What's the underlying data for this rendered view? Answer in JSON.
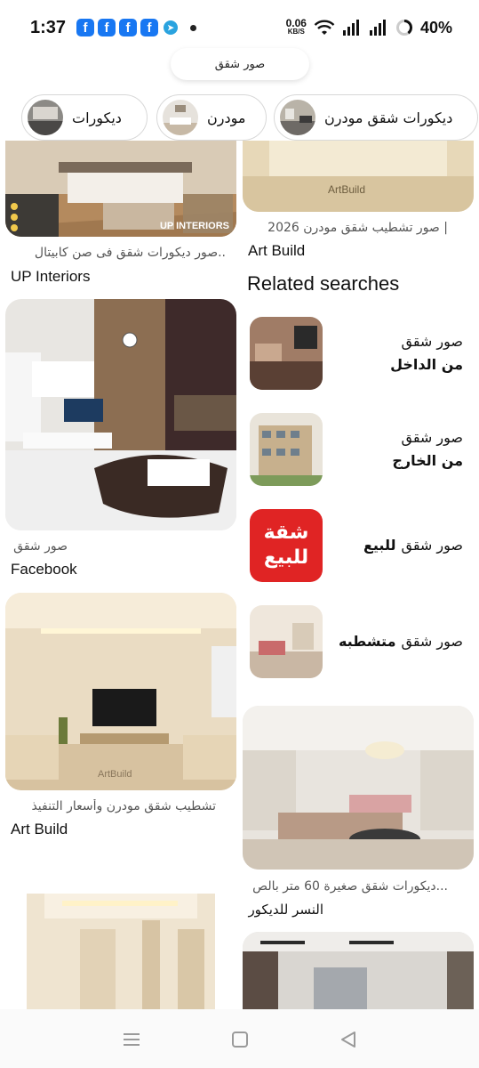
{
  "status_bar": {
    "time": "1:37",
    "notifications": [
      "facebook-icon",
      "facebook-icon",
      "facebook-icon",
      "facebook-icon",
      "telegram-icon"
    ],
    "net_speed_value": "0.06",
    "net_speed_unit": "KB/S",
    "battery": "40%"
  },
  "search": {
    "query": "صور شقق"
  },
  "chips": [
    {
      "label": "ديكورات شقق مودرن"
    },
    {
      "label": "مودرن"
    },
    {
      "label": "ديكورات"
    }
  ],
  "pins_left": [
    {
      "title": "صور ديكورات شقق فى صن كابيتال..",
      "source": "UP Interiors",
      "watermark": "UP INTERIORS"
    },
    {
      "title": "صور شقق",
      "source": "Facebook"
    },
    {
      "title": "تشطيب شقق مودرن وأسعار التنفيذ",
      "source": "Art Build",
      "watermark": "ArtBuild"
    }
  ],
  "pins_right": [
    {
      "title": "صور تشطيب شقق مودرن 2026 |",
      "source": "Art Build",
      "watermark": "ArtBuild"
    },
    {
      "title": "ديكورات شقق صغيرة 60 متر بالص...",
      "source": "النسر للديكور"
    }
  ],
  "related": {
    "heading": "Related searches",
    "items": [
      {
        "line1": "صور شقق",
        "line2": "من الداخل"
      },
      {
        "line1": "صور شقق",
        "line2": "من الخارج"
      },
      {
        "line1": "صور شقق",
        "line2": "للبيع",
        "thumb_text": "شقة للبيع"
      },
      {
        "line1": "صور شقق",
        "line2": "متشطبه"
      }
    ]
  },
  "colors": {
    "accent_facebook": "#1877f2",
    "telegram": "#2aa3df",
    "sale_red": "#e02424"
  }
}
